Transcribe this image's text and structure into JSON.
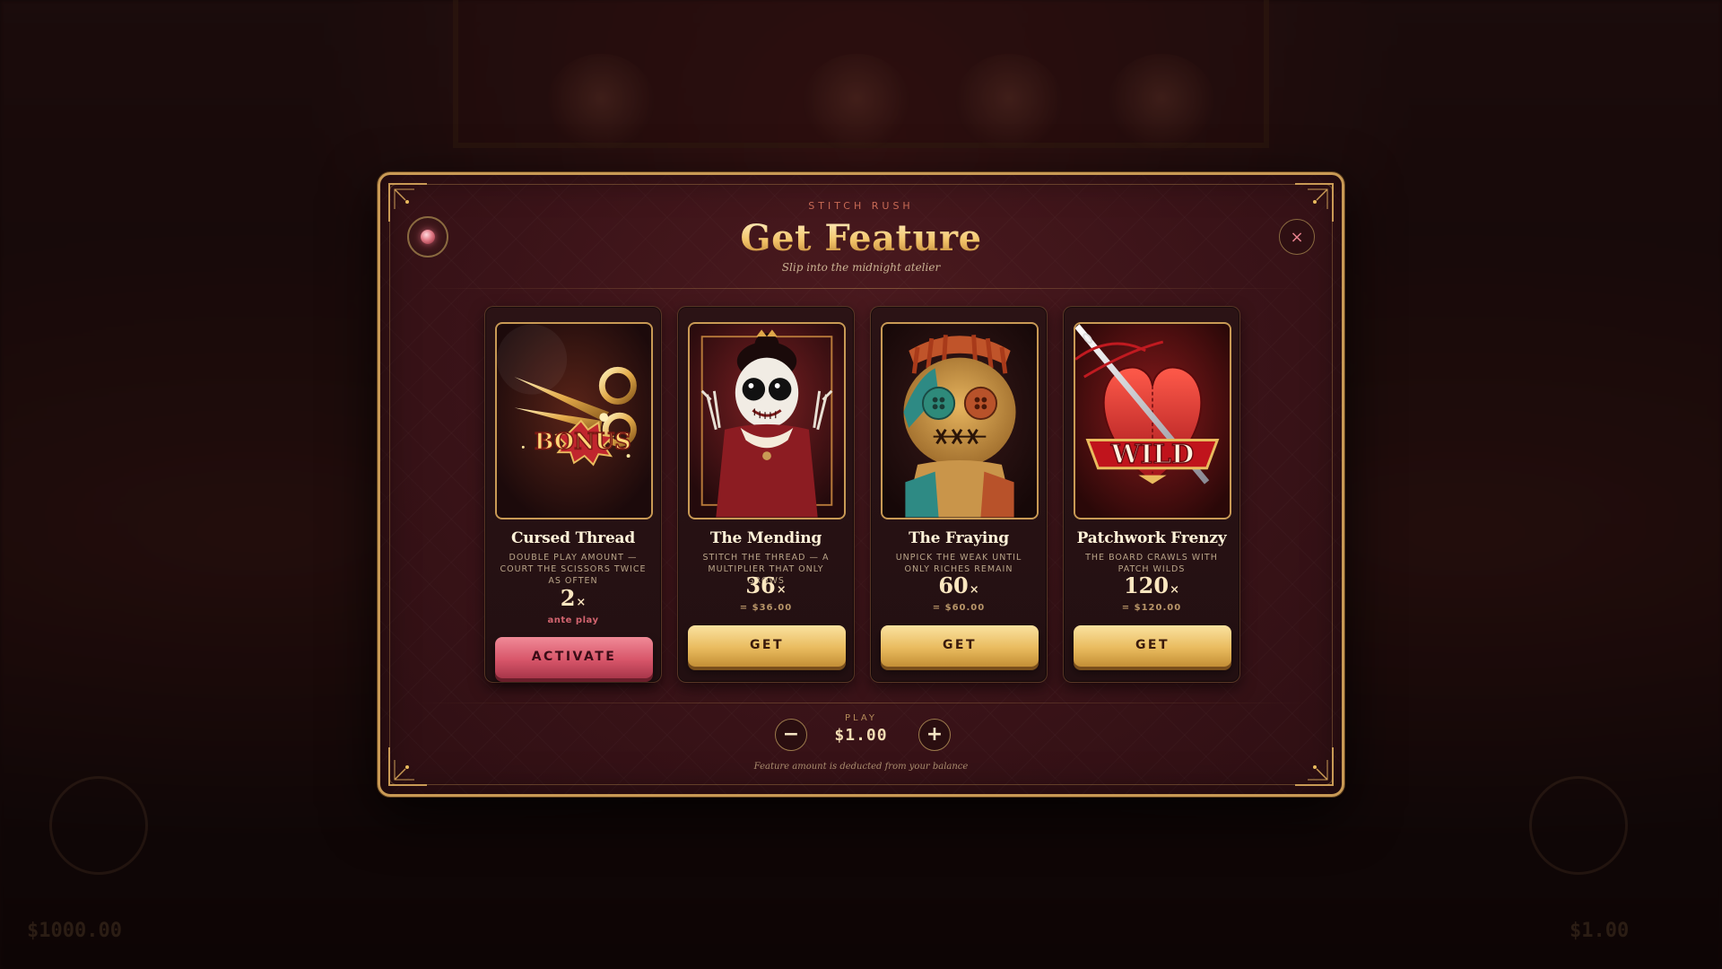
{
  "background": {
    "balance_left": "$1000.00",
    "balance_right": "$1.00"
  },
  "modal": {
    "kicker": "STITCH RUSH",
    "title": "Get Feature",
    "subtitle": "Slip into the midnight atelier",
    "close_symbol": "×",
    "gem_icon": "gem-icon",
    "close_icon": "close-icon"
  },
  "cards": [
    {
      "name": "Cursed Thread",
      "description": "DOUBLE PLAY AMOUNT — COURT THE SCISSORS TWICE AS OFTEN",
      "multiplier": "2",
      "multiplier_suffix": "×",
      "sub": "ante play",
      "button": "ACTIVATE",
      "button_style": "rose",
      "art_icon": "scissors-bonus-icon",
      "art_badge": "BONUS",
      "sub_color": "#d2646f"
    },
    {
      "name": "The Mending",
      "description": "STITCH THE THREAD — A MULTIPLIER THAT ONLY GROWS",
      "multiplier": "36",
      "multiplier_suffix": "×",
      "sub": "= $36.00",
      "button": "GET",
      "button_style": "gold",
      "art_icon": "porcelain-doll-icon",
      "sub_color": "#b89568"
    },
    {
      "name": "The Fraying",
      "description": "UNPICK THE WEAK UNTIL ONLY RICHES REMAIN",
      "multiplier": "60",
      "multiplier_suffix": "×",
      "sub": "= $60.00",
      "button": "GET",
      "button_style": "gold",
      "art_icon": "voodoo-doll-icon",
      "sub_color": "#b89568"
    },
    {
      "name": "Patchwork Frenzy",
      "description": "THE BOARD CRAWLS WITH PATCH WILDS",
      "multiplier": "120",
      "multiplier_suffix": "×",
      "sub": "= $120.00",
      "button": "GET",
      "button_style": "gold",
      "art_icon": "wild-heart-needle-icon",
      "art_badge": "WILD",
      "sub_color": "#b89568"
    }
  ],
  "stake": {
    "label": "PLAY",
    "value": "$1.00",
    "minus": "−",
    "plus": "+"
  },
  "footnote": "Feature amount is deducted from your balance",
  "colors": {
    "gold": "#e9bb5e",
    "rose": "#d8566a",
    "frame": "#c99a55",
    "panel": "#3a1318"
  }
}
